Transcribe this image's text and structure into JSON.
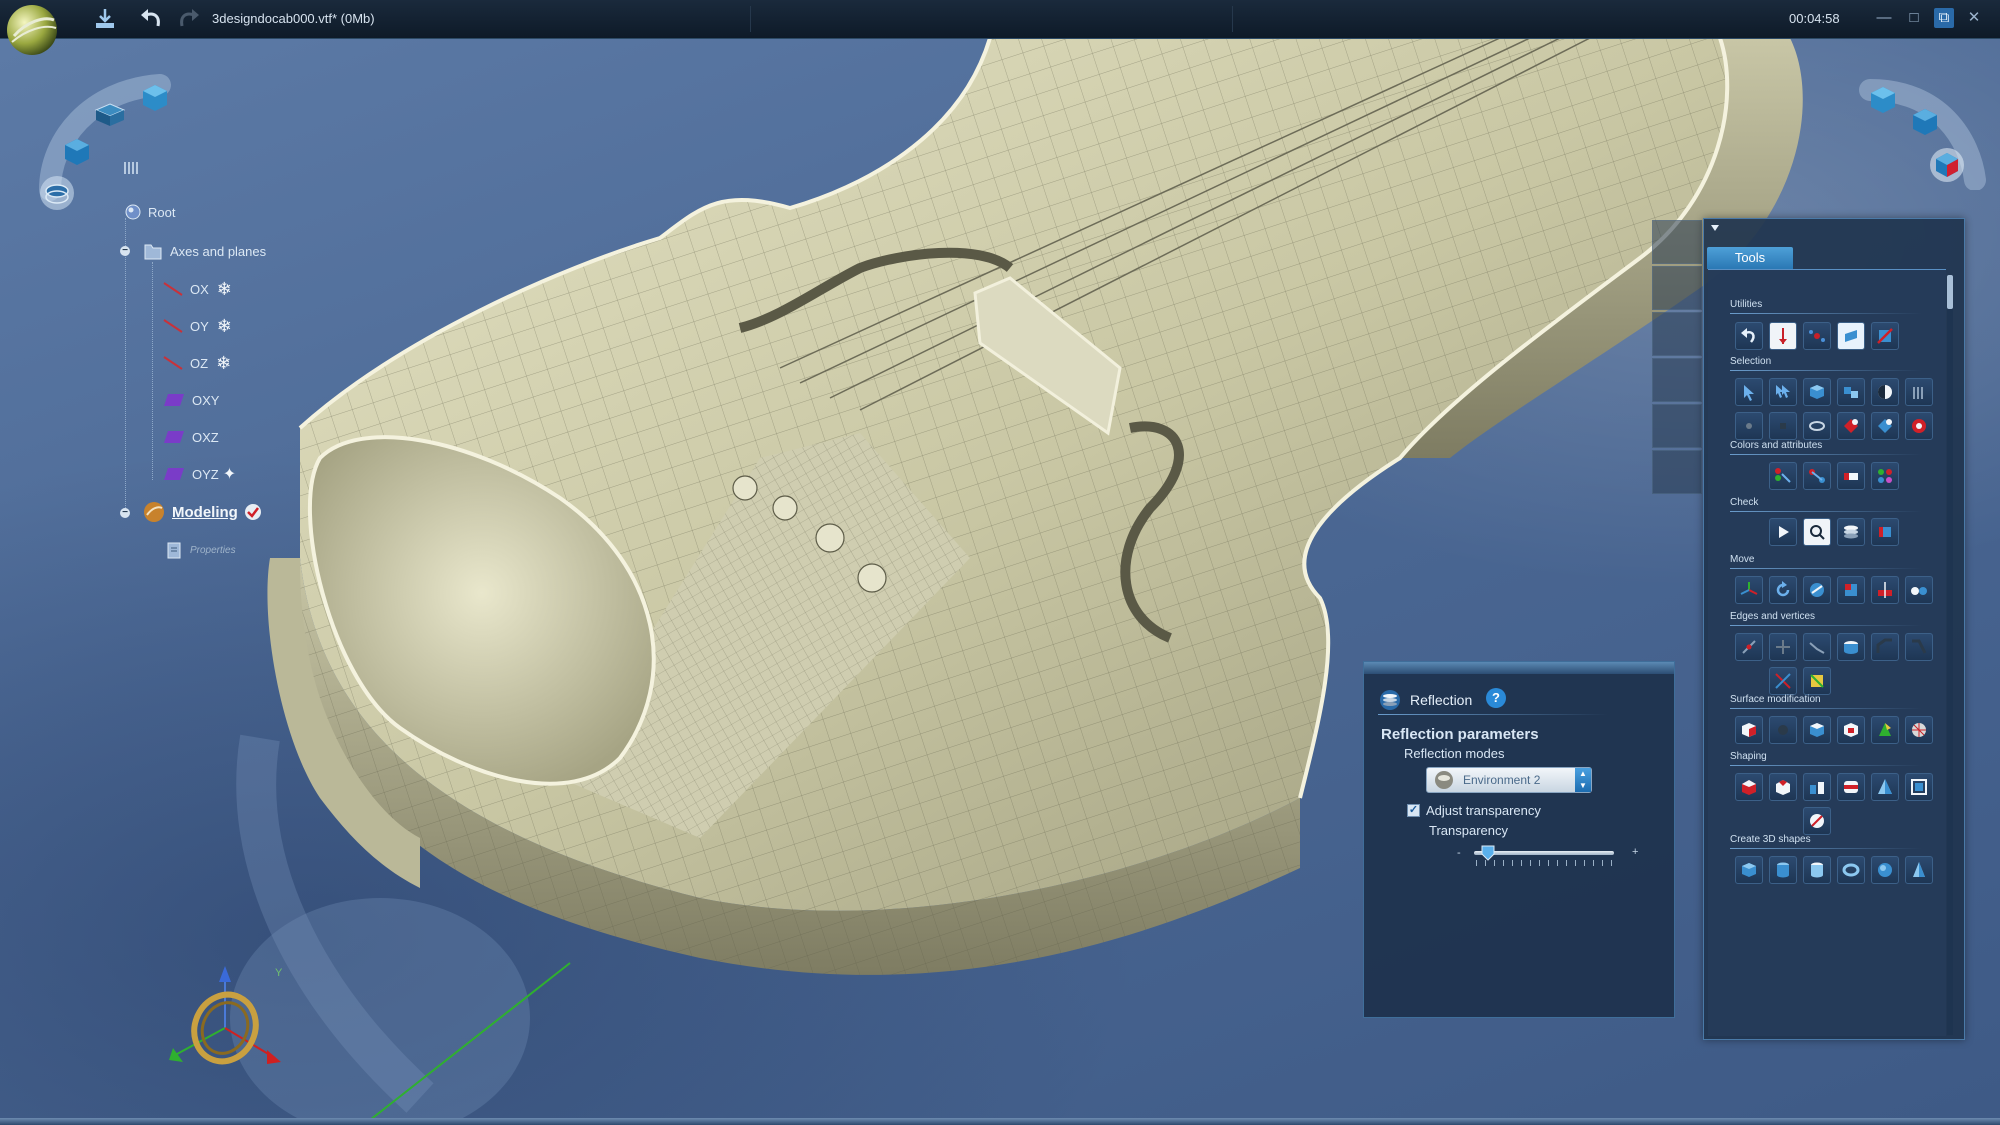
{
  "window": {
    "file_title": "3designdocab000.vtf* (0Mb)",
    "clock": "00:04:58"
  },
  "tree": {
    "root": "Root",
    "axes_and_planes": "Axes and planes",
    "items": [
      "OX",
      "OY",
      "OZ",
      "OXY",
      "OXZ",
      "OYZ"
    ],
    "modeling": "Modeling",
    "properties": "Properties"
  },
  "tools": {
    "tab_label": "Tools",
    "sections": [
      "Utilities",
      "Selection",
      "Colors and attributes",
      "Check",
      "Move",
      "Edges and vertices",
      "Surface modification",
      "Shaping",
      "Create 3D shapes"
    ]
  },
  "reflection": {
    "title": "Reflection",
    "params_heading": "Reflection parameters",
    "modes_label": "Reflection modes",
    "mode_value": "Environment 2",
    "adjust_label": "Adjust transparency",
    "adjust_checked": true,
    "transparency_label": "Transparency",
    "transparency_value": 0.1,
    "slider_min_glyph": "-",
    "slider_max_glyph": "+"
  },
  "colors": {
    "accent": "#3a8fd0",
    "viewport_bg": "#4d6a96",
    "model_surface": "#d6d4b4"
  }
}
